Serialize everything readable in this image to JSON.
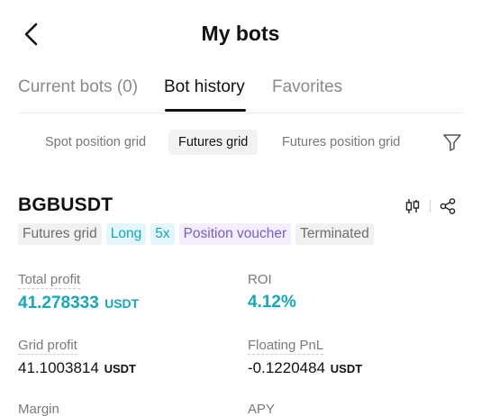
{
  "header": {
    "title": "My bots"
  },
  "tabs": [
    {
      "label": "Current bots (0)",
      "active": false
    },
    {
      "label": "Bot history",
      "active": true
    },
    {
      "label": "Favorites",
      "active": false
    }
  ],
  "subtabs": [
    {
      "label": "Spot position grid",
      "active": false
    },
    {
      "label": "Futures grid",
      "active": true
    },
    {
      "label": "Futures position grid",
      "active": false
    }
  ],
  "bot": {
    "pair": "BGBUSDT",
    "tags": [
      {
        "label": "Futures grid",
        "style": "gray"
      },
      {
        "label": "Long",
        "style": "teal"
      },
      {
        "label": "5x",
        "style": "teal"
      },
      {
        "label": "Position voucher",
        "style": "purple"
      },
      {
        "label": "Terminated",
        "style": "gray"
      }
    ],
    "stats": {
      "total_profit": {
        "label": "Total profit",
        "value": "41.278333",
        "unit": "USDT"
      },
      "roi": {
        "label": "ROI",
        "value": "4.12%"
      },
      "grid_profit": {
        "label": "Grid profit",
        "value": "41.1003814",
        "unit": "USDT"
      },
      "floating_pnl": {
        "label": "Floating PnL",
        "value": "-0.1220484",
        "unit": "USDT"
      },
      "margin": {
        "label": "Margin"
      },
      "apy": {
        "label": "APY"
      }
    }
  },
  "colors": {
    "accent": "#16a7bd",
    "purple": "#7a5cd1",
    "muted": "#8a8a8a"
  },
  "icons": {
    "back": "chevron-left-icon",
    "filter": "filter-icon",
    "chart": "candlestick-icon",
    "share": "share-icon"
  }
}
